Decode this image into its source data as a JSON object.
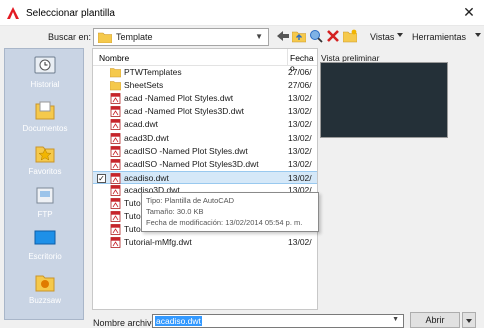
{
  "window": {
    "title": "Seleccionar plantilla"
  },
  "lookin": {
    "label": "Buscar en:",
    "label_underline": "e",
    "value": "Template"
  },
  "toolbar": {
    "views_label": "Vistas",
    "tools_label": "Herramientas",
    "icons": [
      "back-icon",
      "up-folder-icon",
      "search-web-icon",
      "delete-icon",
      "new-folder-icon"
    ]
  },
  "places": [
    {
      "label": "Historial",
      "icon": "history-icon"
    },
    {
      "label": "Documentos",
      "icon": "documents-icon"
    },
    {
      "label": "Favoritos",
      "icon": "favorites-icon"
    },
    {
      "label": "FTP",
      "icon": "ftp-icon"
    },
    {
      "label": "Escritorio",
      "icon": "desktop-icon"
    },
    {
      "label": "Buzzsaw",
      "icon": "buzzsaw-icon"
    }
  ],
  "filelist": {
    "columns": [
      "Nombre",
      "Fecha o"
    ],
    "rows": [
      {
        "name": "PTWTemplates",
        "date": "27/06/",
        "type": "folder"
      },
      {
        "name": "SheetSets",
        "date": "27/06/",
        "type": "folder"
      },
      {
        "name": "acad -Named Plot Styles.dwt",
        "date": "13/02/",
        "type": "dwt"
      },
      {
        "name": "acad -Named Plot Styles3D.dwt",
        "date": "13/02/",
        "type": "dwt"
      },
      {
        "name": "acad.dwt",
        "date": "13/02/",
        "type": "dwt"
      },
      {
        "name": "acad3D.dwt",
        "date": "13/02/",
        "type": "dwt"
      },
      {
        "name": "acadISO -Named Plot Styles.dwt",
        "date": "13/02/",
        "type": "dwt"
      },
      {
        "name": "acadISO -Named Plot Styles3D.dwt",
        "date": "13/02/",
        "type": "dwt"
      },
      {
        "name": "acadiso.dwt",
        "date": "13/02/",
        "type": "dwt",
        "selected": true
      },
      {
        "name": "acadiso3D.dwt",
        "date": "13/02/",
        "type": "dwt"
      },
      {
        "name": "Tutorial-iArch.dwt",
        "date": "13/02/",
        "type": "dwt"
      },
      {
        "name": "Tutorial-iMfg.dwt",
        "date": "13/02/",
        "type": "dwt"
      },
      {
        "name": "Tutorial-mArch.dwt",
        "date": "13/02/",
        "type": "dwt"
      },
      {
        "name": "Tutorial-mMfg.dwt",
        "date": "13/02/",
        "type": "dwt"
      }
    ]
  },
  "tooltip": {
    "line1": "Tipo: Plantilla de AutoCAD",
    "line2": "Tamaño: 30.0 KB",
    "line3": "Fecha de modificación: 13/02/2014 05:54 p. m."
  },
  "preview": {
    "label": "Vista preliminar"
  },
  "filename": {
    "label": "Nombre archivo:",
    "label_underline": "N",
    "value": "acadiso.dwt"
  },
  "open_button": {
    "label": "Abrir"
  },
  "colors": {
    "places_bg": "#c9d4e4",
    "selection": "#d5e8f8",
    "preview_bg": "#243038",
    "input_highlight": "#3399ff"
  }
}
